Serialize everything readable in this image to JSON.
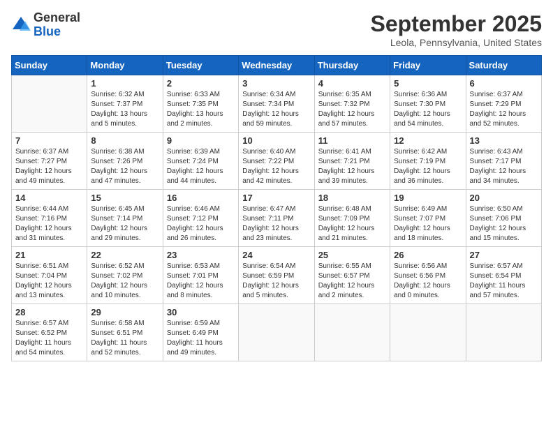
{
  "header": {
    "logo_line1": "General",
    "logo_line2": "Blue",
    "month": "September 2025",
    "location": "Leola, Pennsylvania, United States"
  },
  "weekdays": [
    "Sunday",
    "Monday",
    "Tuesday",
    "Wednesday",
    "Thursday",
    "Friday",
    "Saturday"
  ],
  "weeks": [
    [
      {
        "day": null,
        "info": null
      },
      {
        "day": "1",
        "info": "Sunrise: 6:32 AM\nSunset: 7:37 PM\nDaylight: 13 hours\nand 5 minutes."
      },
      {
        "day": "2",
        "info": "Sunrise: 6:33 AM\nSunset: 7:35 PM\nDaylight: 13 hours\nand 2 minutes."
      },
      {
        "day": "3",
        "info": "Sunrise: 6:34 AM\nSunset: 7:34 PM\nDaylight: 12 hours\nand 59 minutes."
      },
      {
        "day": "4",
        "info": "Sunrise: 6:35 AM\nSunset: 7:32 PM\nDaylight: 12 hours\nand 57 minutes."
      },
      {
        "day": "5",
        "info": "Sunrise: 6:36 AM\nSunset: 7:30 PM\nDaylight: 12 hours\nand 54 minutes."
      },
      {
        "day": "6",
        "info": "Sunrise: 6:37 AM\nSunset: 7:29 PM\nDaylight: 12 hours\nand 52 minutes."
      }
    ],
    [
      {
        "day": "7",
        "info": "Sunrise: 6:37 AM\nSunset: 7:27 PM\nDaylight: 12 hours\nand 49 minutes."
      },
      {
        "day": "8",
        "info": "Sunrise: 6:38 AM\nSunset: 7:26 PM\nDaylight: 12 hours\nand 47 minutes."
      },
      {
        "day": "9",
        "info": "Sunrise: 6:39 AM\nSunset: 7:24 PM\nDaylight: 12 hours\nand 44 minutes."
      },
      {
        "day": "10",
        "info": "Sunrise: 6:40 AM\nSunset: 7:22 PM\nDaylight: 12 hours\nand 42 minutes."
      },
      {
        "day": "11",
        "info": "Sunrise: 6:41 AM\nSunset: 7:21 PM\nDaylight: 12 hours\nand 39 minutes."
      },
      {
        "day": "12",
        "info": "Sunrise: 6:42 AM\nSunset: 7:19 PM\nDaylight: 12 hours\nand 36 minutes."
      },
      {
        "day": "13",
        "info": "Sunrise: 6:43 AM\nSunset: 7:17 PM\nDaylight: 12 hours\nand 34 minutes."
      }
    ],
    [
      {
        "day": "14",
        "info": "Sunrise: 6:44 AM\nSunset: 7:16 PM\nDaylight: 12 hours\nand 31 minutes."
      },
      {
        "day": "15",
        "info": "Sunrise: 6:45 AM\nSunset: 7:14 PM\nDaylight: 12 hours\nand 29 minutes."
      },
      {
        "day": "16",
        "info": "Sunrise: 6:46 AM\nSunset: 7:12 PM\nDaylight: 12 hours\nand 26 minutes."
      },
      {
        "day": "17",
        "info": "Sunrise: 6:47 AM\nSunset: 7:11 PM\nDaylight: 12 hours\nand 23 minutes."
      },
      {
        "day": "18",
        "info": "Sunrise: 6:48 AM\nSunset: 7:09 PM\nDaylight: 12 hours\nand 21 minutes."
      },
      {
        "day": "19",
        "info": "Sunrise: 6:49 AM\nSunset: 7:07 PM\nDaylight: 12 hours\nand 18 minutes."
      },
      {
        "day": "20",
        "info": "Sunrise: 6:50 AM\nSunset: 7:06 PM\nDaylight: 12 hours\nand 15 minutes."
      }
    ],
    [
      {
        "day": "21",
        "info": "Sunrise: 6:51 AM\nSunset: 7:04 PM\nDaylight: 12 hours\nand 13 minutes."
      },
      {
        "day": "22",
        "info": "Sunrise: 6:52 AM\nSunset: 7:02 PM\nDaylight: 12 hours\nand 10 minutes."
      },
      {
        "day": "23",
        "info": "Sunrise: 6:53 AM\nSunset: 7:01 PM\nDaylight: 12 hours\nand 8 minutes."
      },
      {
        "day": "24",
        "info": "Sunrise: 6:54 AM\nSunset: 6:59 PM\nDaylight: 12 hours\nand 5 minutes."
      },
      {
        "day": "25",
        "info": "Sunrise: 6:55 AM\nSunset: 6:57 PM\nDaylight: 12 hours\nand 2 minutes."
      },
      {
        "day": "26",
        "info": "Sunrise: 6:56 AM\nSunset: 6:56 PM\nDaylight: 12 hours\nand 0 minutes."
      },
      {
        "day": "27",
        "info": "Sunrise: 6:57 AM\nSunset: 6:54 PM\nDaylight: 11 hours\nand 57 minutes."
      }
    ],
    [
      {
        "day": "28",
        "info": "Sunrise: 6:57 AM\nSunset: 6:52 PM\nDaylight: 11 hours\nand 54 minutes."
      },
      {
        "day": "29",
        "info": "Sunrise: 6:58 AM\nSunset: 6:51 PM\nDaylight: 11 hours\nand 52 minutes."
      },
      {
        "day": "30",
        "info": "Sunrise: 6:59 AM\nSunset: 6:49 PM\nDaylight: 11 hours\nand 49 minutes."
      },
      {
        "day": null,
        "info": null
      },
      {
        "day": null,
        "info": null
      },
      {
        "day": null,
        "info": null
      },
      {
        "day": null,
        "info": null
      }
    ]
  ]
}
